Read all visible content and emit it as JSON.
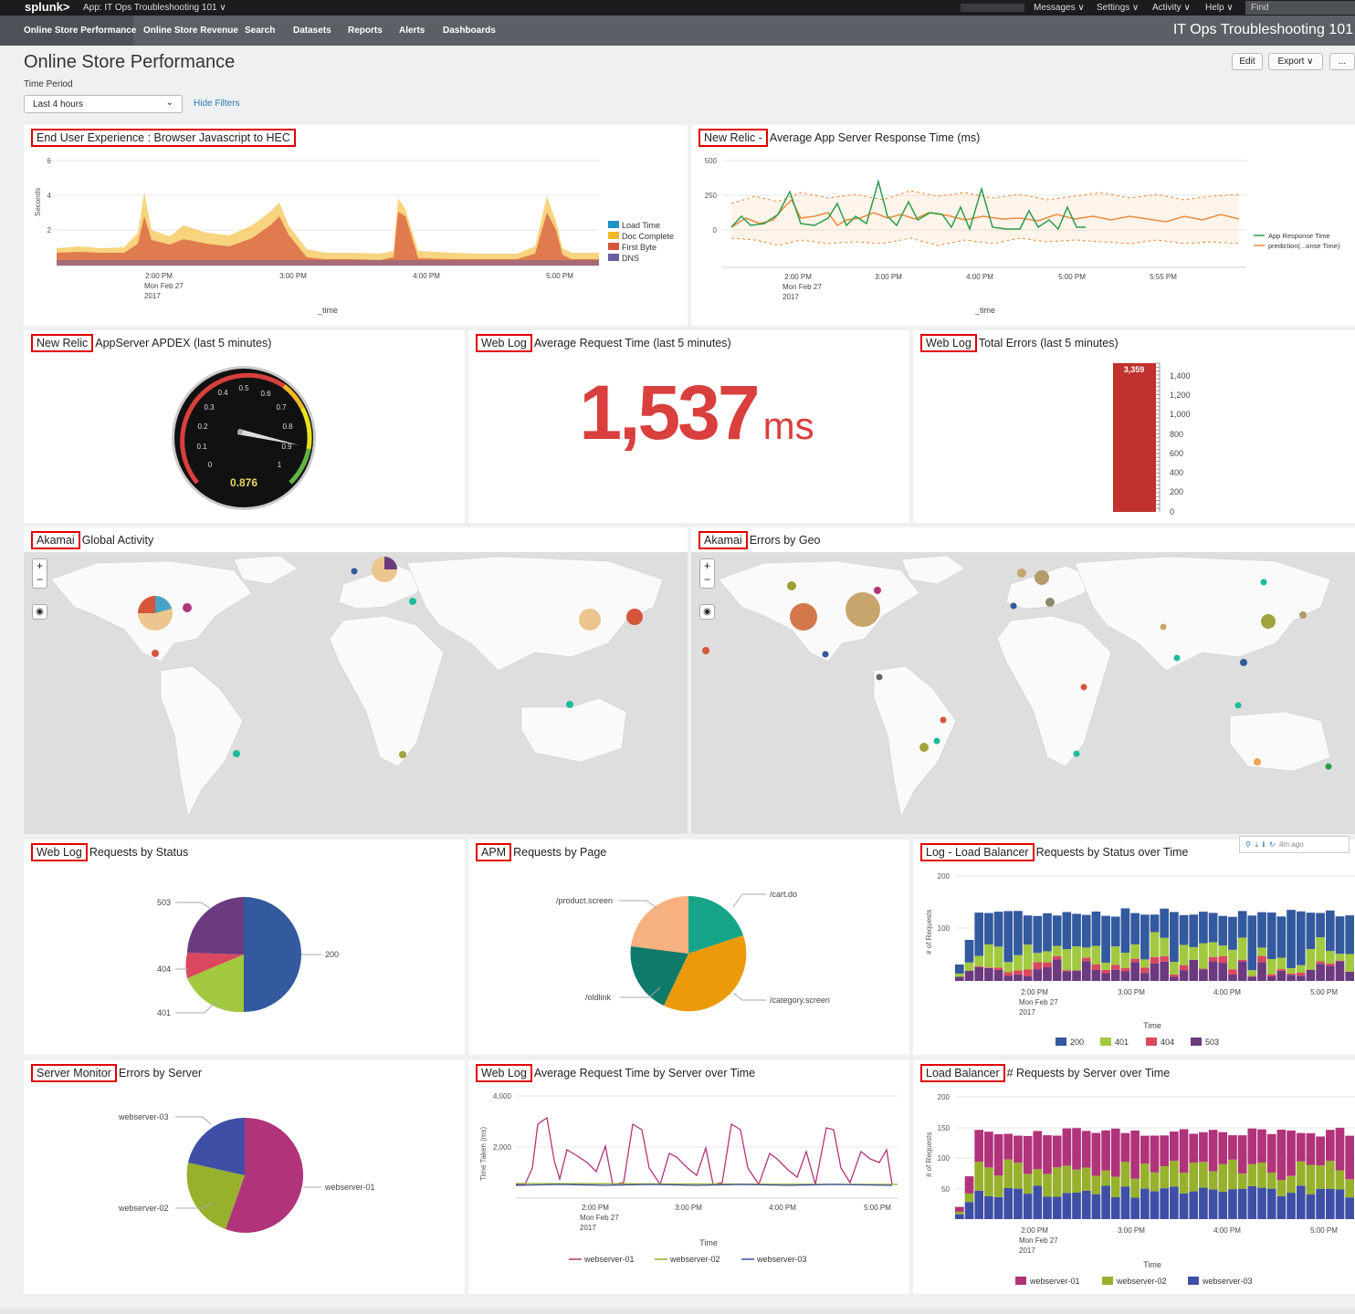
{
  "topbar": {
    "logo": "splunk>",
    "app": "App: IT Ops Troubleshooting 101 ∨",
    "messages": "Messages ∨",
    "settings": "Settings ∨",
    "activity": "Activity ∨",
    "help": "Help ∨",
    "find": "Find"
  },
  "nav": {
    "items": [
      "Online Store Performance",
      "Online Store Revenue",
      "Search",
      "Datasets",
      "Reports",
      "Alerts",
      "Dashboards"
    ],
    "app_title": "IT Ops Troubleshooting 101"
  },
  "page": {
    "title": "Online Store Performance",
    "time_label": "Time Period",
    "time_value": "Last 4 hours",
    "hide_filters": "Hide Filters",
    "edit": "Edit",
    "export": "Export ∨",
    "more": "..."
  },
  "panels": {
    "eux": {
      "tag": "End User Experience : Browser Javascript to HEC",
      "ylabel": "Seconds",
      "xlabel": "_time",
      "yticks": [
        "6",
        "4",
        "2"
      ],
      "xticks": [
        "2:00 PM",
        "3:00 PM",
        "4:00 PM",
        "5:00 PM"
      ],
      "date": [
        "Mon Feb 27",
        "2017"
      ],
      "legend": [
        "Load Time",
        "Doc Complete",
        "First Byte",
        "DNS"
      ]
    },
    "nr_resp": {
      "tag": "New Relic -",
      "title": "Average App Server Response Time (ms)",
      "yticks": [
        "500",
        "250",
        "0"
      ],
      "xticks": [
        "2:00 PM",
        "3:00 PM",
        "4:00 PM",
        "5:00 PM",
        "5:55 PM"
      ],
      "date": [
        "Mon Feb 27",
        "2017"
      ],
      "xlabel": "_time",
      "legend": [
        "App Response Time",
        "prediction(...onse Time)"
      ]
    },
    "apdex": {
      "tag": "New Relic",
      "title": "AppServer APDEX (last 5 minutes)",
      "value": "0.876",
      "ticks": [
        "0",
        "0.1",
        "0.2",
        "0.3",
        "0.4",
        "0.5",
        "0.6",
        "0.7",
        "0.8",
        "0.9",
        "1"
      ]
    },
    "avgreq": {
      "tag": "Web Log",
      "title": "Average Request Time (last 5 minutes)",
      "value": "1,537",
      "unit": "ms"
    },
    "errors": {
      "tag": "Web Log",
      "title": "Total Errors (last 5 minutes)",
      "value": "3,359",
      "ticks": [
        "1,400",
        "1,200",
        "1,000",
        "800",
        "600",
        "400",
        "200",
        "0"
      ]
    },
    "global": {
      "tag": "Akamai",
      "title": "Global Activity"
    },
    "geo": {
      "tag": "Akamai",
      "title": "Errors by Geo"
    },
    "status": {
      "tag": "Web Log",
      "title": "Requests by Status",
      "labels": [
        "503",
        "200",
        "404",
        "401"
      ]
    },
    "pages": {
      "tag": "APM",
      "title": "Requests by Page",
      "labels": [
        "/product.screen",
        "/cart.do",
        "/oldlink",
        "/category.screen"
      ]
    },
    "lb_status": {
      "tag": "Log - Load Balancer",
      "title": "Requests by Status over Time",
      "ylabel": "# of Requests",
      "yticks": [
        "200",
        "100"
      ],
      "xticks": [
        "2:00 PM",
        "3:00 PM",
        "4:00 PM",
        "5:00 PM"
      ],
      "date": [
        "Mon Feb 27",
        "2017"
      ],
      "xlabel": "Time",
      "legend": [
        "200",
        "401",
        "404",
        "503"
      ],
      "ago": "4m ago"
    },
    "servers": {
      "tag": "Server Monitor",
      "title": "Errors by Server",
      "labels": [
        "webserver-03",
        "webserver-01",
        "webserver-02"
      ]
    },
    "reqtime": {
      "tag": "Web Log",
      "title": "Average Request Time by Server over Time",
      "ylabel": "Time Taken (ms)",
      "yticks": [
        "4,000",
        "2,000"
      ],
      "xticks": [
        "2:00 PM",
        "3:00 PM",
        "4:00 PM",
        "5:00 PM"
      ],
      "date": [
        "Mon Feb 27",
        "2017"
      ],
      "xlabel": "Time",
      "legend": [
        "webserver-01",
        "webserver-02",
        "webserver-03"
      ]
    },
    "lb_server": {
      "tag": "Load Balancer",
      "title": "# Requests by Server over Time",
      "ylabel": "# of Requests",
      "yticks": [
        "200",
        "150",
        "100",
        "50"
      ],
      "xticks": [
        "2:00 PM",
        "3:00 PM",
        "4:00 PM",
        "5:00 PM"
      ],
      "date": [
        "Mon Feb 27",
        "2017"
      ],
      "xlabel": "Time",
      "legend": [
        "webserver-01",
        "webserver-02",
        "webserver-03"
      ]
    }
  },
  "colors": {
    "load": "#1e93c6",
    "doc": "#f2b827",
    "first": "#d6563c",
    "dns": "#6a5c9e",
    "s200": "#33599e",
    "s401": "#a2c93f",
    "s404": "#d9485e",
    "s503": "#6b3a7f",
    "ws01": "#b1337a",
    "ws02": "#97b12d",
    "ws03": "#3f4fa5",
    "red": "#d93f3c"
  }
}
